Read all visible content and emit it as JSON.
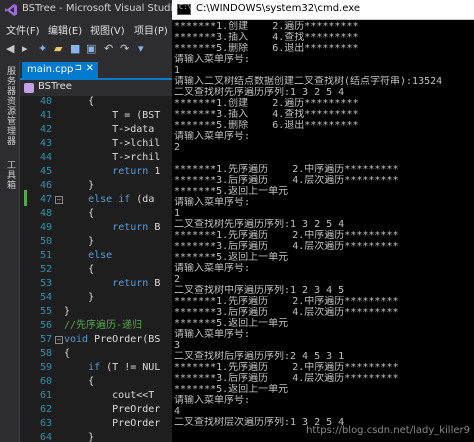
{
  "vs": {
    "title": "BSTree - Microsoft Visual Studio",
    "menu": [
      "文件(F)",
      "编辑(E)",
      "视图(V)",
      "项目(P)"
    ],
    "sidebar_tabs": [
      "服务器资源管理器",
      "工具箱"
    ],
    "tab": {
      "label": "main.cpp",
      "pin": "⊐",
      "close": "✕"
    },
    "scope": "BSTree",
    "code_lines": [
      {
        "n": "40",
        "t": "    {"
      },
      {
        "n": "41",
        "t": "        T = (BST"
      },
      {
        "n": "42",
        "t": "        T->data"
      },
      {
        "n": "43",
        "t": "        T->lchil"
      },
      {
        "n": "44",
        "t": "        T->rchil"
      },
      {
        "n": "45",
        "t": "        return 1"
      },
      {
        "n": "46",
        "t": "    }"
      },
      {
        "n": "47",
        "t": "    else if (da"
      },
      {
        "n": "48",
        "t": "    {"
      },
      {
        "n": "49",
        "t": "        return B"
      },
      {
        "n": "50",
        "t": "    }"
      },
      {
        "n": "51",
        "t": "    else"
      },
      {
        "n": "52",
        "t": "    {"
      },
      {
        "n": "53",
        "t": "        return B"
      },
      {
        "n": "54",
        "t": "    }"
      },
      {
        "n": "55",
        "t": "}"
      },
      {
        "n": "56",
        "t": "//先序遍历-递归"
      },
      {
        "n": "57",
        "t": "void PreOrder(BS"
      },
      {
        "n": "58",
        "t": "{"
      },
      {
        "n": "59",
        "t": "    if (T != NUL"
      },
      {
        "n": "60",
        "t": "    {"
      },
      {
        "n": "61",
        "t": "        cout<<T"
      },
      {
        "n": "62",
        "t": "        PreOrder"
      },
      {
        "n": "63",
        "t": "        PreOrder"
      },
      {
        "n": "64",
        "t": "    }"
      }
    ]
  },
  "cmd": {
    "title": "C:\\WINDOWS\\system32\\cmd.exe",
    "icon_text": "C:\\",
    "lines": [
      "*******1.创建    2.遍历*********",
      "*******3.插入    4.查找*********",
      "*******5.删除    6.退出*********",
      "请输入菜单序号:",
      "1",
      "请输入二叉树结点数据创建二叉查找树(结点字符串):13524",
      "二叉查找树先序遍历序列:1 3 2 5 4",
      "*******1.创建    2.遍历*********",
      "*******3.插入    4.查找*********",
      "*******5.删除    6.退出*********",
      "请输入菜单序号:",
      "2",
      "",
      "*******1.先序遍历    2.中序遍历*********",
      "*******3.后序遍历    4.层次遍历*********",
      "*******5.返回上一单元",
      "请输入菜单序号:",
      "1",
      "二叉查找树先序遍历序列:1 3 2 5 4",
      "*******1.先序遍历    2.中序遍历*********",
      "*******3.后序遍历    4.层次遍历*********",
      "*******5.返回上一单元",
      "请输入菜单序号:",
      "2",
      "二叉查找树中序遍历序列:1 2 3 4 5",
      "*******1.先序遍历    2.中序遍历*********",
      "*******3.后序遍历    4.层次遍历*********",
      "*******5.返回上一单元",
      "请输入菜单序号:",
      "3",
      "二叉查找树后序遍历序列:2 4 5 3 1",
      "*******1.先序遍历    2.中序遍历*********",
      "*******3.后序遍历    4.层次遍历*********",
      "*******5.返回上一单元",
      "请输入菜单序号:",
      "4",
      "二叉查找树层次遍历序列:1 3 2 5 4"
    ],
    "watermark": "https://blog.csdn.net/lady_killer9"
  }
}
